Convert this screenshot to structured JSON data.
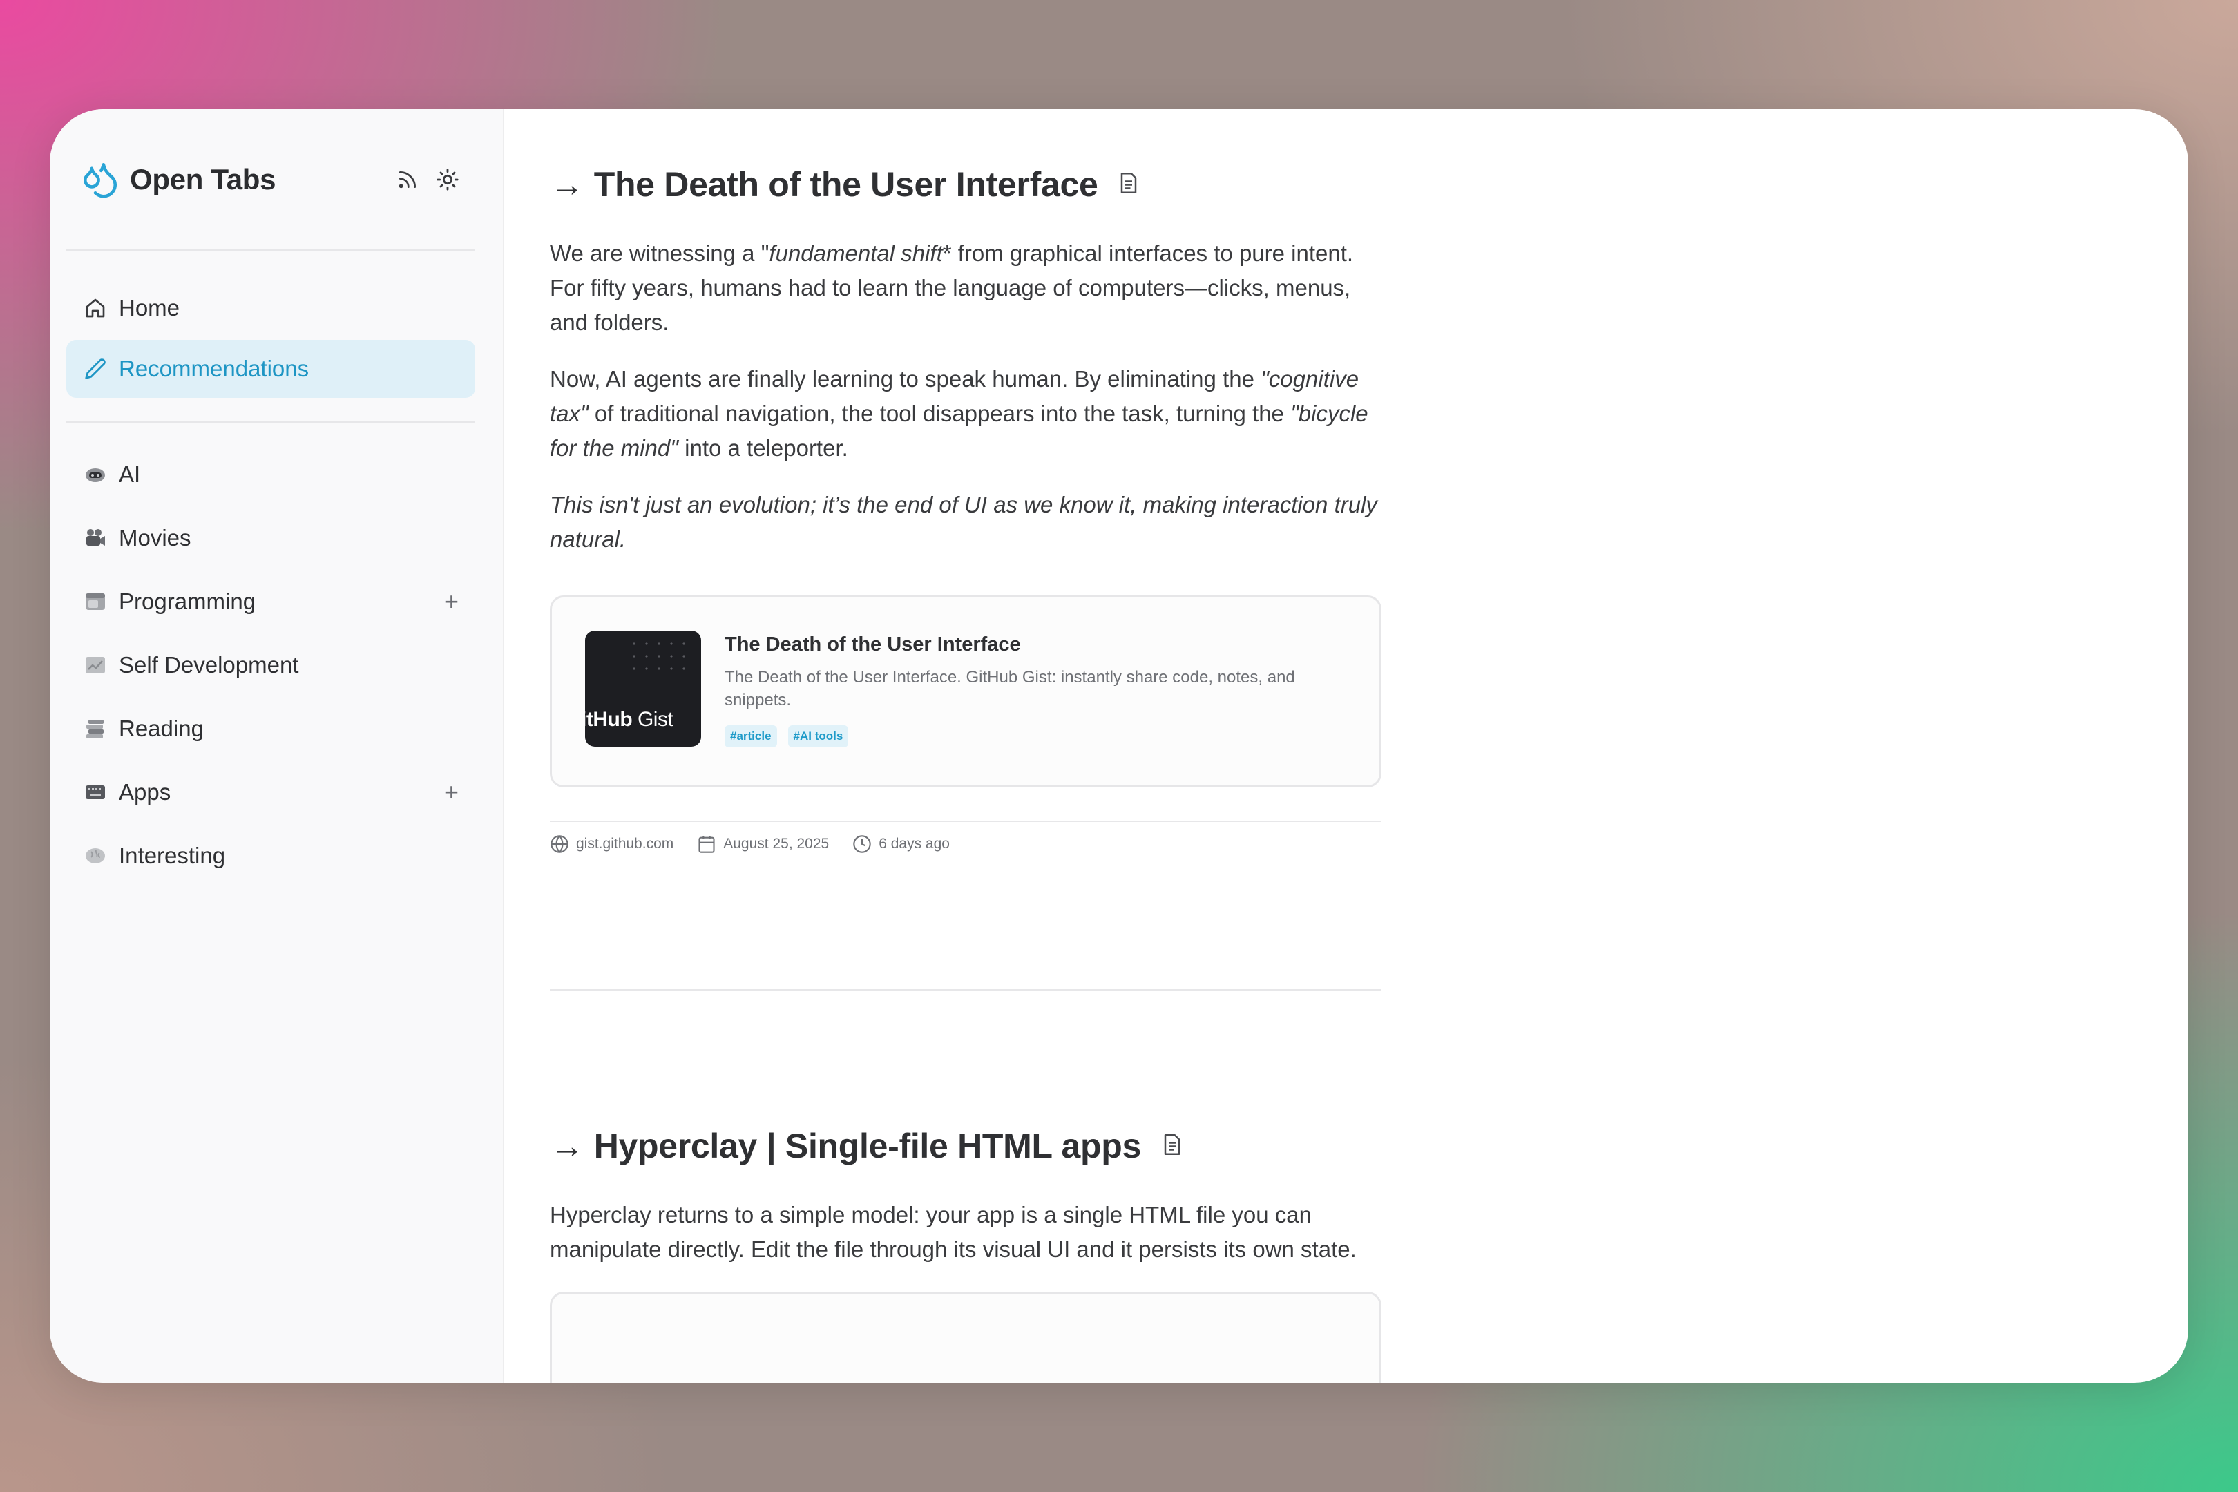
{
  "app": {
    "title": "Open Tabs"
  },
  "nav": {
    "home": "Home",
    "recommendations": "Recommendations"
  },
  "categories": [
    {
      "label": "AI",
      "icon": "robot-icon",
      "has_add": false
    },
    {
      "label": "Movies",
      "icon": "movie-camera-icon",
      "has_add": false
    },
    {
      "label": "Programming",
      "icon": "window-icon",
      "has_add": true
    },
    {
      "label": "Self Development",
      "icon": "chart-icon",
      "has_add": false
    },
    {
      "label": "Reading",
      "icon": "books-icon",
      "has_add": false
    },
    {
      "label": "Apps",
      "icon": "keyboard-icon",
      "has_add": true
    },
    {
      "label": "Interesting",
      "icon": "brain-icon",
      "has_add": false
    }
  ],
  "articles": [
    {
      "arrow": "→",
      "title": "The Death of the User Interface",
      "p1": {
        "a": "We are witnessing a \"",
        "b": "fundamental shift",
        "c": "* from graphical interfaces to pure intent. For fifty years, humans had to learn the language of computers—clicks, menus, and folders."
      },
      "p2": {
        "a": "Now, AI agents are finally learning to speak human. By eliminating the ",
        "b": "\"cognitive tax\"",
        "c": " of traditional navigation, the tool disappears into the task, turning the ",
        "d": "\"bicycle for the mind\"",
        "e": " into a teleporter."
      },
      "p3": "This isn't just an evolution; it’s the end of UI as we know it, making interaction truly natural.",
      "card": {
        "thumb_bold": "itHub",
        "thumb_text": " Gist",
        "title": "The Death of the User Interface",
        "desc": "The Death of the User Interface. GitHub Gist: instantly share code, notes, and snippets.",
        "tags": [
          "#article",
          "#AI tools"
        ]
      },
      "meta": {
        "domain": "gist.github.com",
        "date": "August 25, 2025",
        "ago": "6 days ago"
      }
    },
    {
      "arrow": "→",
      "title": "Hyperclay | Single-file HTML apps",
      "p1": "Hyperclay returns to a simple model: your app is a single HTML file you can manipulate directly. Edit the file through its visual UI and it persists its own state."
    }
  ],
  "colors": {
    "accent": "#1d95c4",
    "active_bg": "#dff0f8",
    "tag_bg": "#e1f2f9"
  }
}
